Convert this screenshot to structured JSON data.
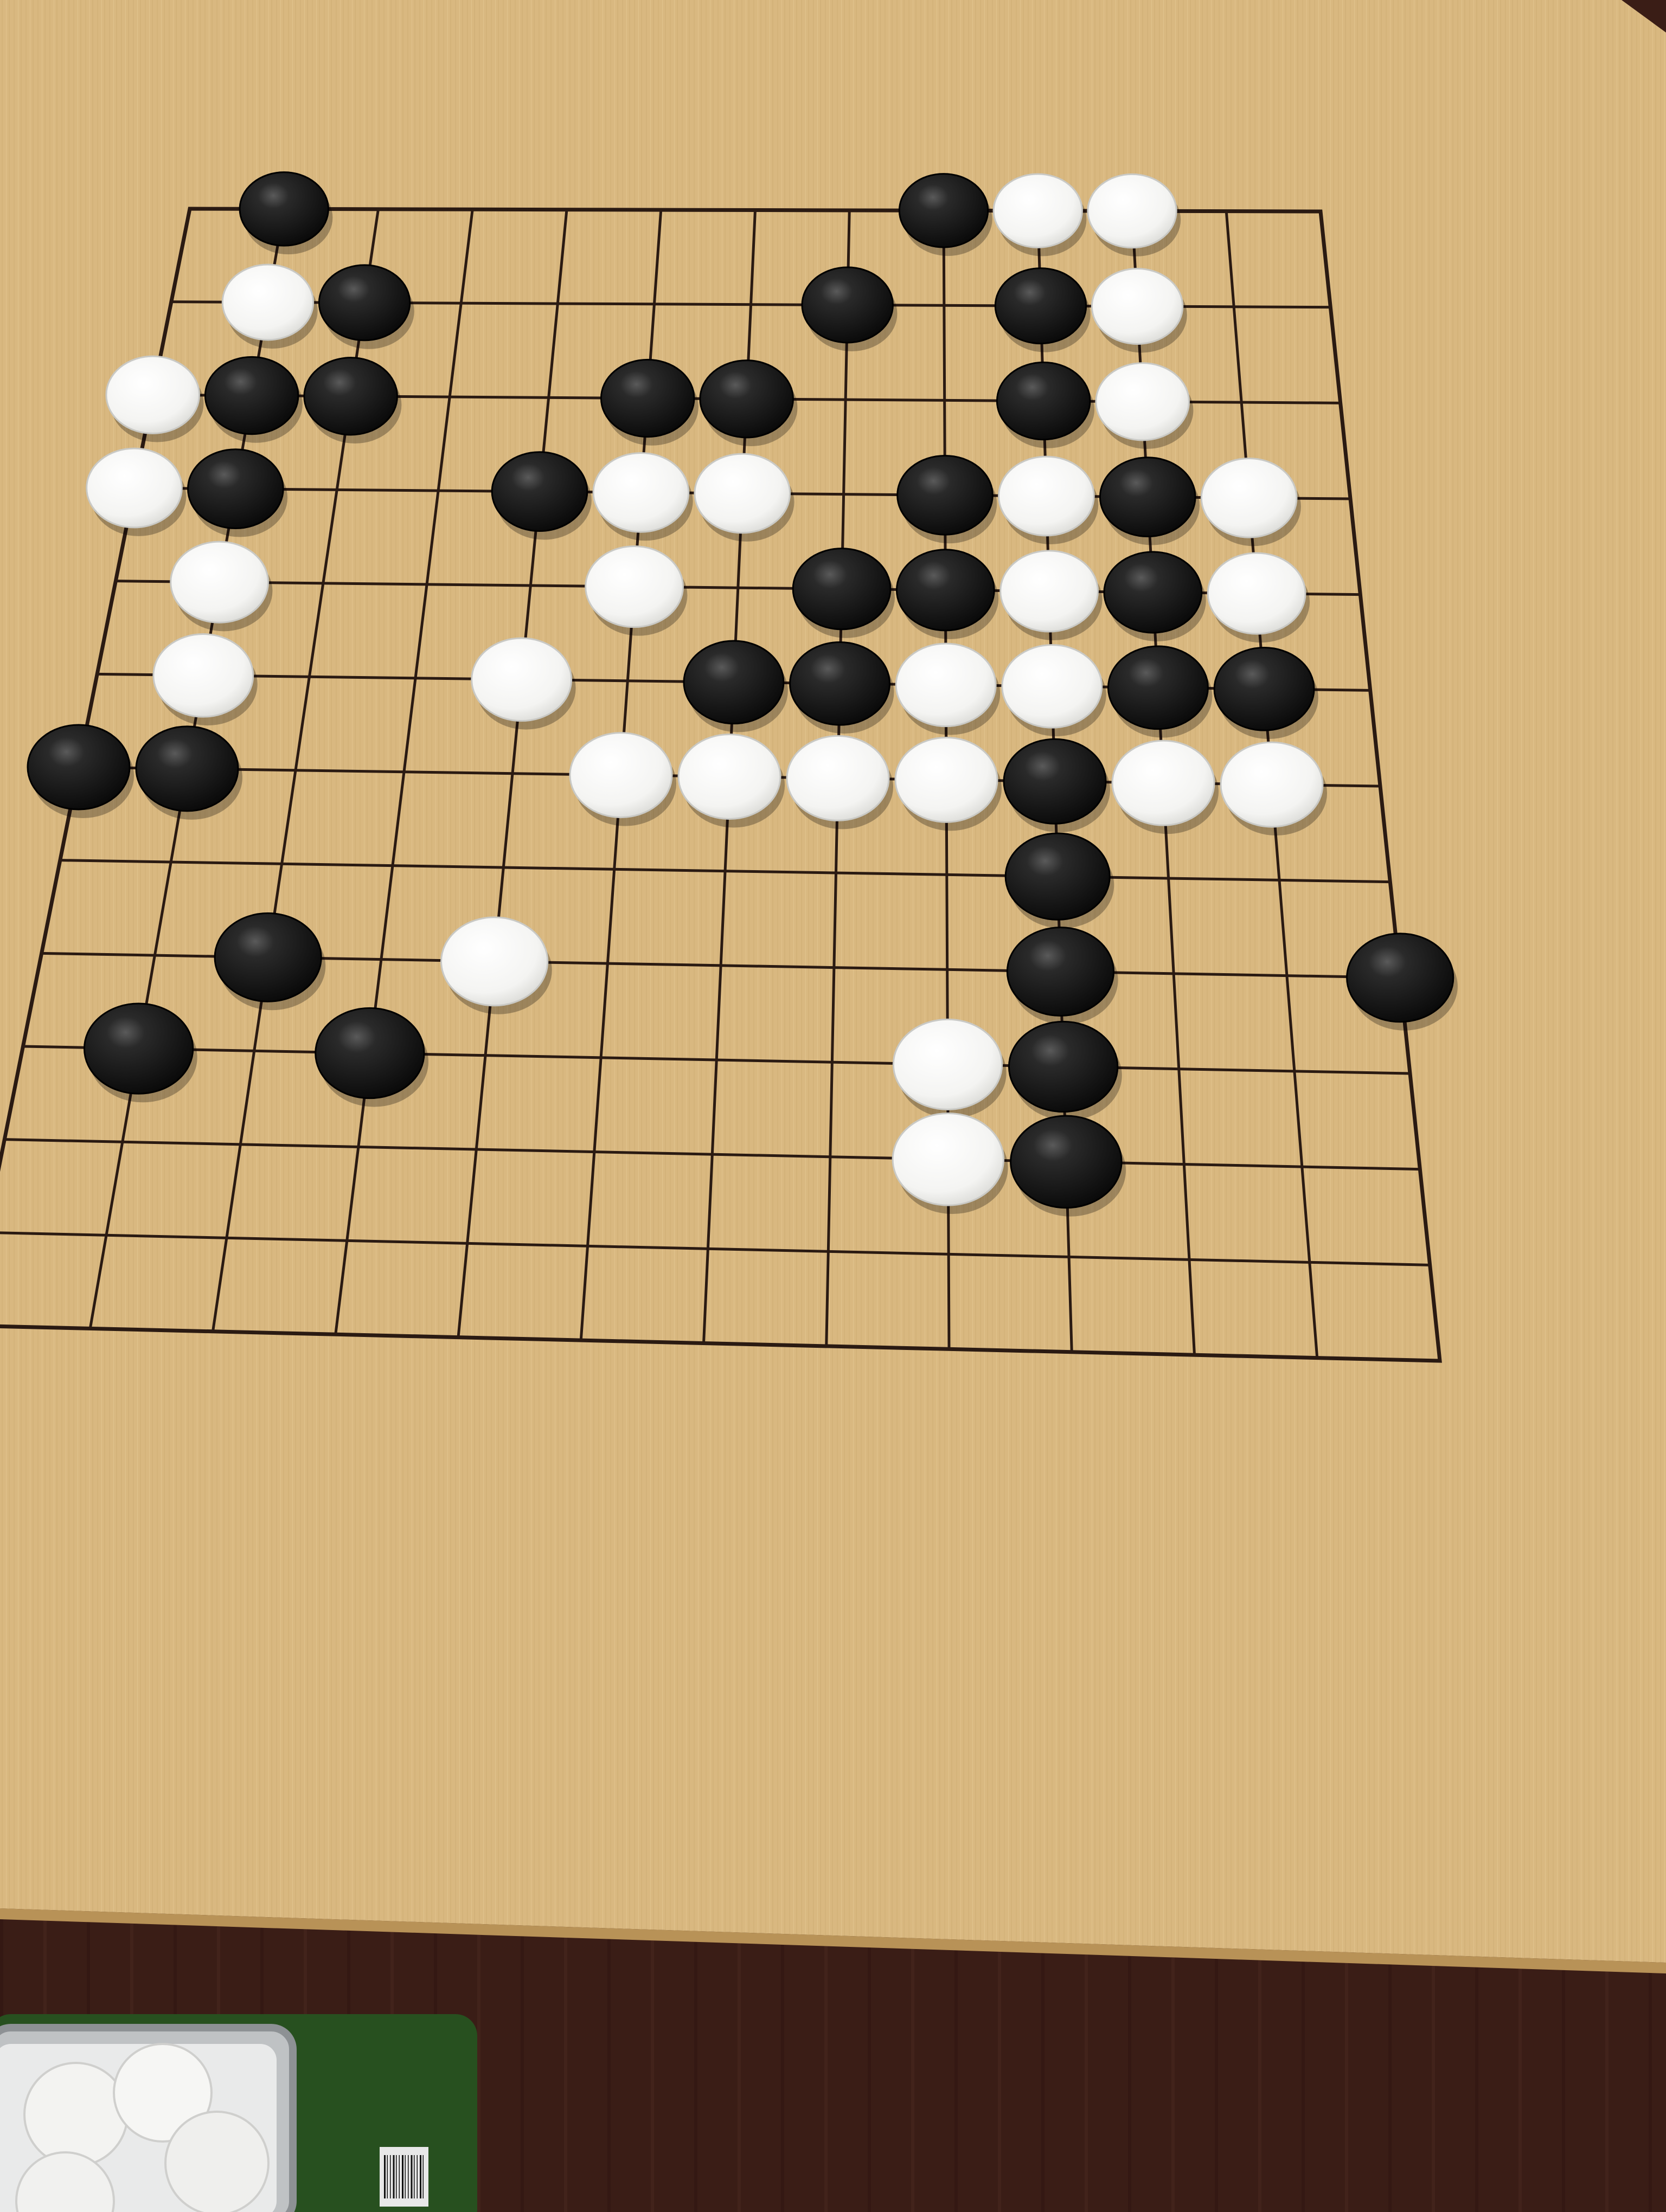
{
  "board": {
    "size": 13,
    "colors": {
      "wood": "#d9b880",
      "wood_light": "#e2c48f",
      "wood_dark": "#c9a66c",
      "grid_line": "#2a1a12",
      "black_stone": "#141414",
      "white_stone": "#f8f8f6",
      "table": "#3a1d16",
      "container_green": "#27501f"
    },
    "stones": [
      {
        "color": "black",
        "col": 1,
        "row": 0
      },
      {
        "color": "black",
        "col": 8,
        "row": 0
      },
      {
        "color": "white",
        "col": 9,
        "row": 0
      },
      {
        "color": "white",
        "col": 10,
        "row": 0
      },
      {
        "color": "white",
        "col": 1,
        "row": 1
      },
      {
        "color": "black",
        "col": 2,
        "row": 1
      },
      {
        "color": "black",
        "col": 7,
        "row": 1
      },
      {
        "color": "black",
        "col": 9,
        "row": 1
      },
      {
        "color": "white",
        "col": 10,
        "row": 1
      },
      {
        "color": "white",
        "col": 0,
        "row": 2
      },
      {
        "color": "black",
        "col": 1,
        "row": 2
      },
      {
        "color": "black",
        "col": 2,
        "row": 2
      },
      {
        "color": "black",
        "col": 5,
        "row": 2
      },
      {
        "color": "black",
        "col": 6,
        "row": 2
      },
      {
        "color": "black",
        "col": 9,
        "row": 2
      },
      {
        "color": "white",
        "col": 10,
        "row": 2
      },
      {
        "color": "white",
        "col": 0,
        "row": 3
      },
      {
        "color": "black",
        "col": 1,
        "row": 3
      },
      {
        "color": "black",
        "col": 4,
        "row": 3
      },
      {
        "color": "white",
        "col": 5,
        "row": 3
      },
      {
        "color": "white",
        "col": 6,
        "row": 3
      },
      {
        "color": "black",
        "col": 8,
        "row": 3
      },
      {
        "color": "white",
        "col": 9,
        "row": 3
      },
      {
        "color": "black",
        "col": 10,
        "row": 3
      },
      {
        "color": "white",
        "col": 11,
        "row": 3
      },
      {
        "color": "white",
        "col": 1,
        "row": 4
      },
      {
        "color": "white",
        "col": 5,
        "row": 4
      },
      {
        "color": "black",
        "col": 7,
        "row": 4
      },
      {
        "color": "black",
        "col": 8,
        "row": 4
      },
      {
        "color": "white",
        "col": 9,
        "row": 4
      },
      {
        "color": "black",
        "col": 10,
        "row": 4
      },
      {
        "color": "white",
        "col": 11,
        "row": 4
      },
      {
        "color": "white",
        "col": 1,
        "row": 5
      },
      {
        "color": "white",
        "col": 4,
        "row": 5
      },
      {
        "color": "black",
        "col": 6,
        "row": 5
      },
      {
        "color": "black",
        "col": 7,
        "row": 5
      },
      {
        "color": "white",
        "col": 8,
        "row": 5
      },
      {
        "color": "white",
        "col": 9,
        "row": 5
      },
      {
        "color": "black",
        "col": 10,
        "row": 5
      },
      {
        "color": "black",
        "col": 11,
        "row": 5
      },
      {
        "color": "black",
        "col": 0,
        "row": 6
      },
      {
        "color": "black",
        "col": 1,
        "row": 6
      },
      {
        "color": "white",
        "col": 5,
        "row": 6
      },
      {
        "color": "white",
        "col": 6,
        "row": 6
      },
      {
        "color": "white",
        "col": 7,
        "row": 6
      },
      {
        "color": "white",
        "col": 8,
        "row": 6
      },
      {
        "color": "black",
        "col": 9,
        "row": 6
      },
      {
        "color": "white",
        "col": 10,
        "row": 6
      },
      {
        "color": "white",
        "col": 11,
        "row": 6
      },
      {
        "color": "black",
        "col": 9,
        "row": 7
      },
      {
        "color": "black",
        "col": 2,
        "row": 8
      },
      {
        "color": "white",
        "col": 4,
        "row": 8
      },
      {
        "color": "black",
        "col": 9,
        "row": 8
      },
      {
        "color": "black",
        "col": 12,
        "row": 8
      },
      {
        "color": "black",
        "col": 1,
        "row": 9
      },
      {
        "color": "black",
        "col": 3,
        "row": 9
      },
      {
        "color": "white",
        "col": 8,
        "row": 9
      },
      {
        "color": "black",
        "col": 9,
        "row": 9
      },
      {
        "color": "white",
        "col": 8,
        "row": 10
      },
      {
        "color": "black",
        "col": 9,
        "row": 10
      }
    ]
  }
}
